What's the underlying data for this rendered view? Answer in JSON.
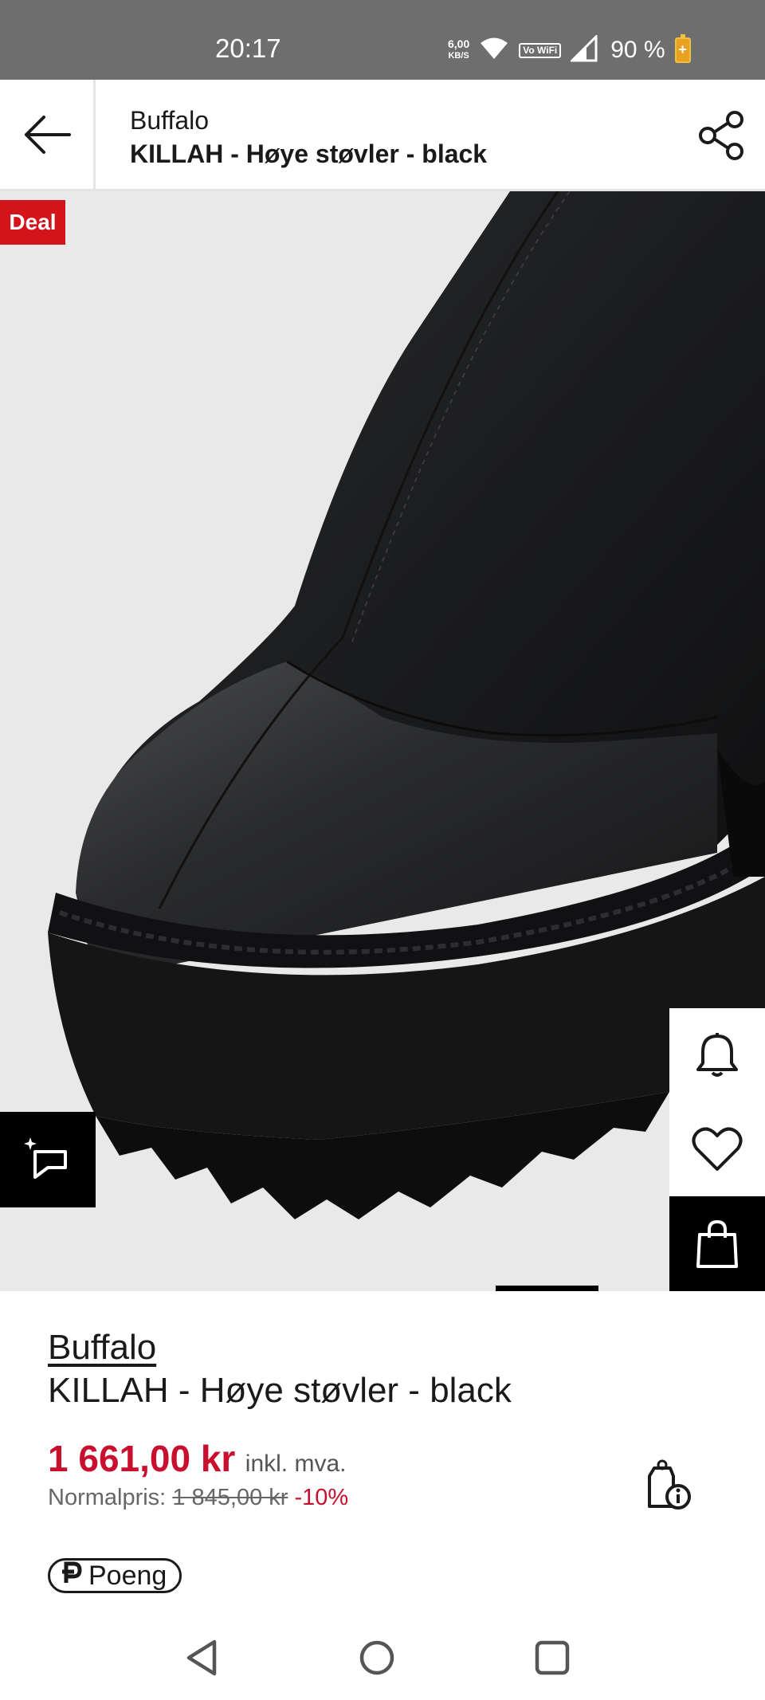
{
  "status_bar": {
    "time": "20:17",
    "net_speed_value": "6,00",
    "net_speed_unit": "KB/S",
    "vowifi": "Vo WiFi",
    "battery": "90 %"
  },
  "header": {
    "brand": "Buffalo",
    "product": "KILLAH - Høye støvler - black"
  },
  "image": {
    "badge": "Deal",
    "description_icon": "boot-photo"
  },
  "product": {
    "brand": "Buffalo",
    "name": "KILLAH - Høye støvler - black",
    "price": "1 661,00 kr",
    "vat_note": "inkl. mva.",
    "normal_label": "Normalpris:",
    "normal_price": "1 845,00 kr",
    "discount": "-10%",
    "points_label": "Poeng"
  },
  "colors": {
    "accent_red": "#c8102e",
    "deal_red": "#d4141b",
    "status_bar": "#6e6e6e"
  }
}
